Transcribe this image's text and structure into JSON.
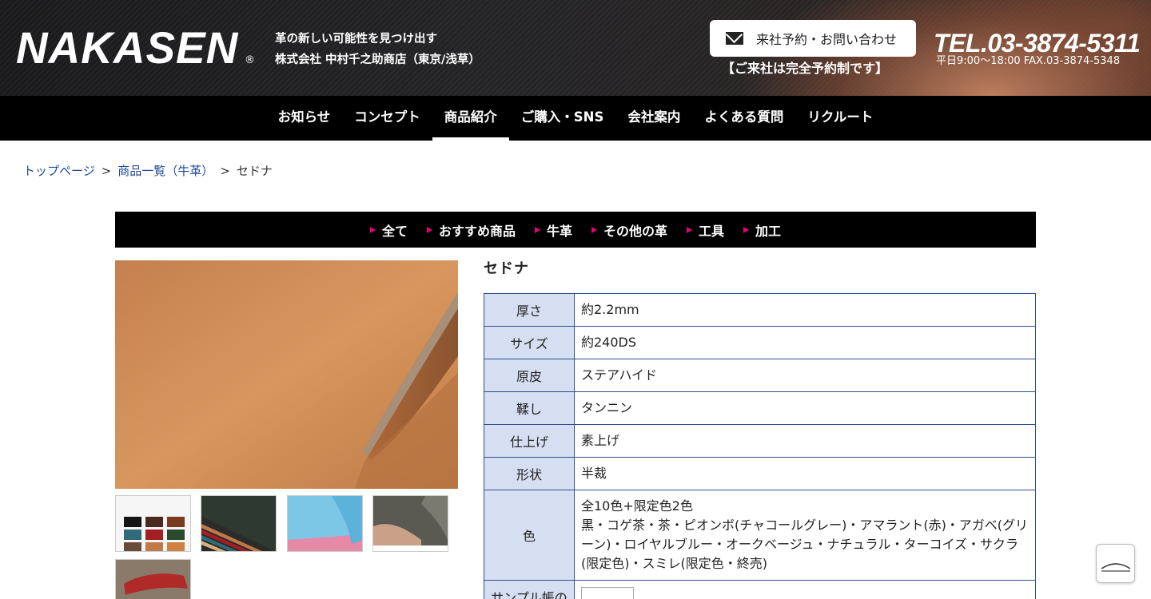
{
  "header": {
    "logo_text": "NAKASEN",
    "logo_mark": "®",
    "tagline_1": "革の新しい可能性を見つけ出す",
    "tagline_2": "株式会社 中村千之助商店（東京/浅草）",
    "contact_label": "来社予約・お問い合わせ",
    "reserve_note": "【ご来社は完全予約制です】",
    "tel": "TEL.03-3874-5311",
    "tel_sub": "平日9:00～18:00 FAX.03-3874-5348"
  },
  "nav": {
    "items": [
      {
        "label": "お知らせ"
      },
      {
        "label": "コンセプト"
      },
      {
        "label": "商品紹介"
      },
      {
        "label": "ご購入・SNS"
      },
      {
        "label": "会社案内"
      },
      {
        "label": "よくある質問"
      },
      {
        "label": "リクルート"
      }
    ],
    "active": "商品紹介"
  },
  "breadcrumb": {
    "home": "トップページ",
    "category": "商品一覧（牛革）",
    "current": "セドナ",
    "separator": ">"
  },
  "categories": [
    {
      "label": "全て"
    },
    {
      "label": "おすすめ商品"
    },
    {
      "label": "牛革"
    },
    {
      "label": "その他の革"
    },
    {
      "label": "工具"
    },
    {
      "label": "加工"
    }
  ],
  "product": {
    "title": "セドナ",
    "specs": [
      {
        "key": "厚さ",
        "value": "約2.2mm"
      },
      {
        "key": "サイズ",
        "value": "約240DS"
      },
      {
        "key": "原皮",
        "value": "ステアハイド"
      },
      {
        "key": "鞣し",
        "value": "タンニン"
      },
      {
        "key": "仕上げ",
        "value": "素上げ"
      },
      {
        "key": "形状",
        "value": "半裁"
      },
      {
        "key": "色",
        "value_line1": "全10色+限定色2色",
        "value_line2": "黒・コゲ茶・茶・ピオンボ(チャコールグレー)・アマラント(赤)・アガベ(グリーン)・ロイヤルブルー・オークベージュ・ナチュラル・ターコイズ・サクラ(限定色)・スミレ(限定色・終売)"
      },
      {
        "key": "サンプル帳の"
      }
    ]
  },
  "colors": {
    "header_bg": "#1b1b1d",
    "nav_bg": "#000000",
    "link": "#1e4a9a",
    "table_border": "#2e4f8f",
    "table_key_bg": "#d6def2",
    "category_arrow": "#e5007f"
  },
  "icons": {
    "contact": "mail-icon",
    "pagetop": "chevron-up-icon"
  }
}
